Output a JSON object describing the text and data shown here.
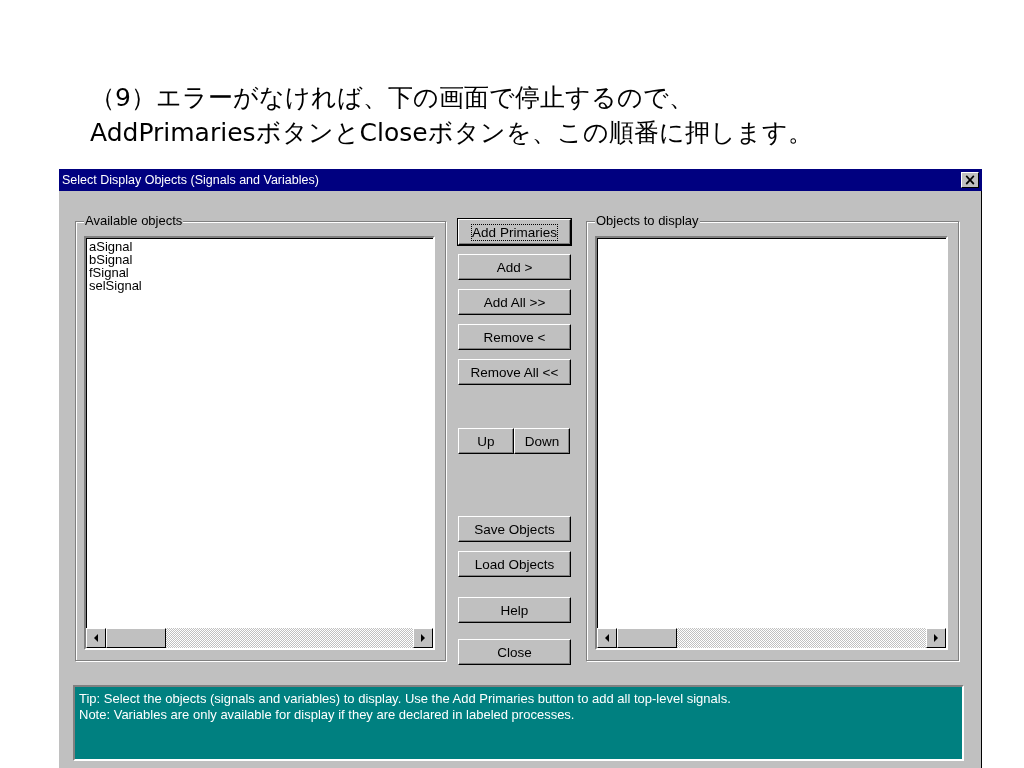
{
  "slide": {
    "heading_lines": [
      "（9）エラーがなければ、下の画面で停止するので、",
      "AddPrimariesボタンとCloseボタンを、この順番に押します。"
    ]
  },
  "window": {
    "title": "Select Display Objects (Signals and Variables)",
    "close_glyph": "×"
  },
  "available": {
    "label": "Available objects",
    "items": [
      "aSignal",
      "bSignal",
      "fSignal",
      "selSignal"
    ]
  },
  "button_groups": [
    {
      "kind": "column",
      "buttons": [
        {
          "label": "Add Primaries",
          "default": true
        },
        {
          "label": "Add >",
          "default": false
        },
        {
          "label": "Add All >>",
          "default": false
        },
        {
          "label": "Remove <",
          "default": false
        },
        {
          "label": "Remove All <<",
          "default": false
        }
      ]
    },
    {
      "kind": "row",
      "buttons": [
        {
          "label": "Up",
          "default": false
        },
        {
          "label": "Down",
          "default": false
        }
      ]
    },
    {
      "kind": "column",
      "buttons": [
        {
          "label": "Save Objects",
          "default": false
        },
        {
          "label": "Load Objects",
          "default": false
        }
      ]
    },
    {
      "kind": "column",
      "buttons": [
        {
          "label": "Help",
          "default": false
        }
      ]
    },
    {
      "kind": "column",
      "buttons": [
        {
          "label": "Close",
          "default": false
        }
      ]
    }
  ],
  "display": {
    "label": "Objects to display"
  },
  "tip": [
    "Tip: Select the objects (signals and variables) to display. Use the Add Primaries button to add all top-level signals.",
    "Note: Variables are only available for display if they are declared in labeled processes."
  ]
}
